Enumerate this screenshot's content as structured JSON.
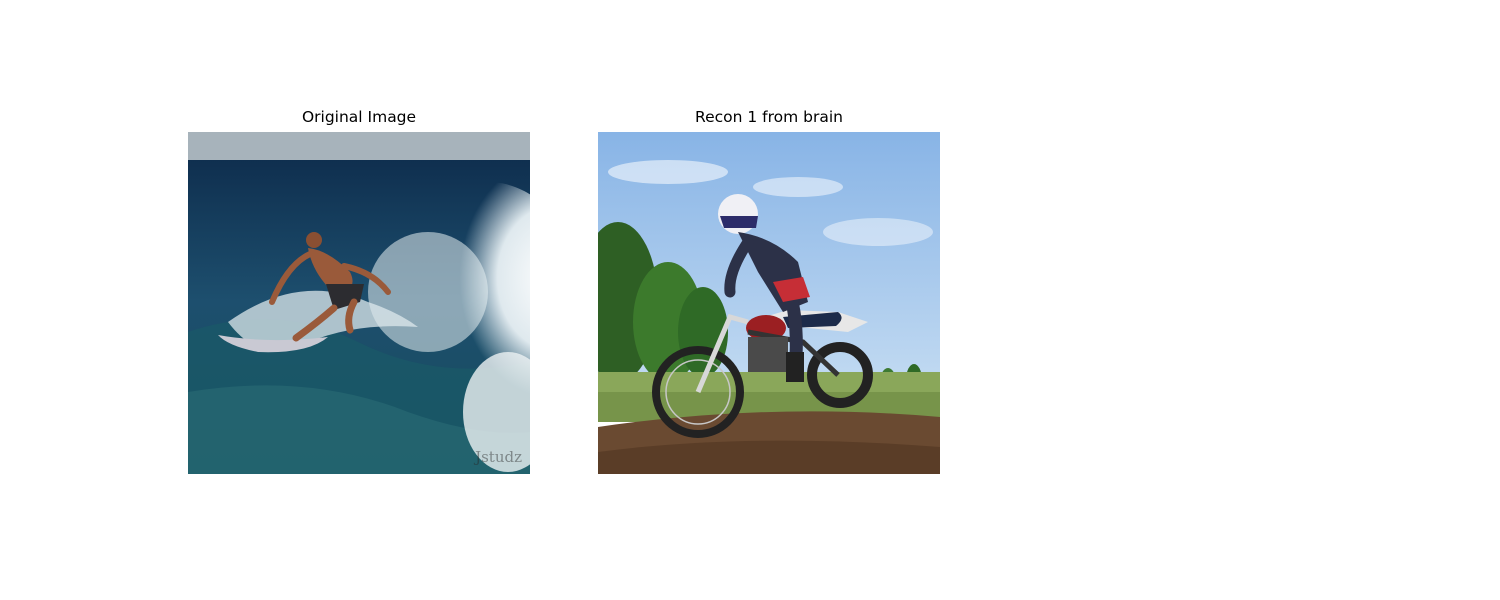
{
  "figure": {
    "panels": [
      {
        "title": "Original Image",
        "subject": "surfer riding a breaking wave"
      },
      {
        "title": "Recon 1 from brain",
        "subject": "motocross rider on a dirt bike"
      }
    ],
    "watermark_text": "Jstudz"
  }
}
